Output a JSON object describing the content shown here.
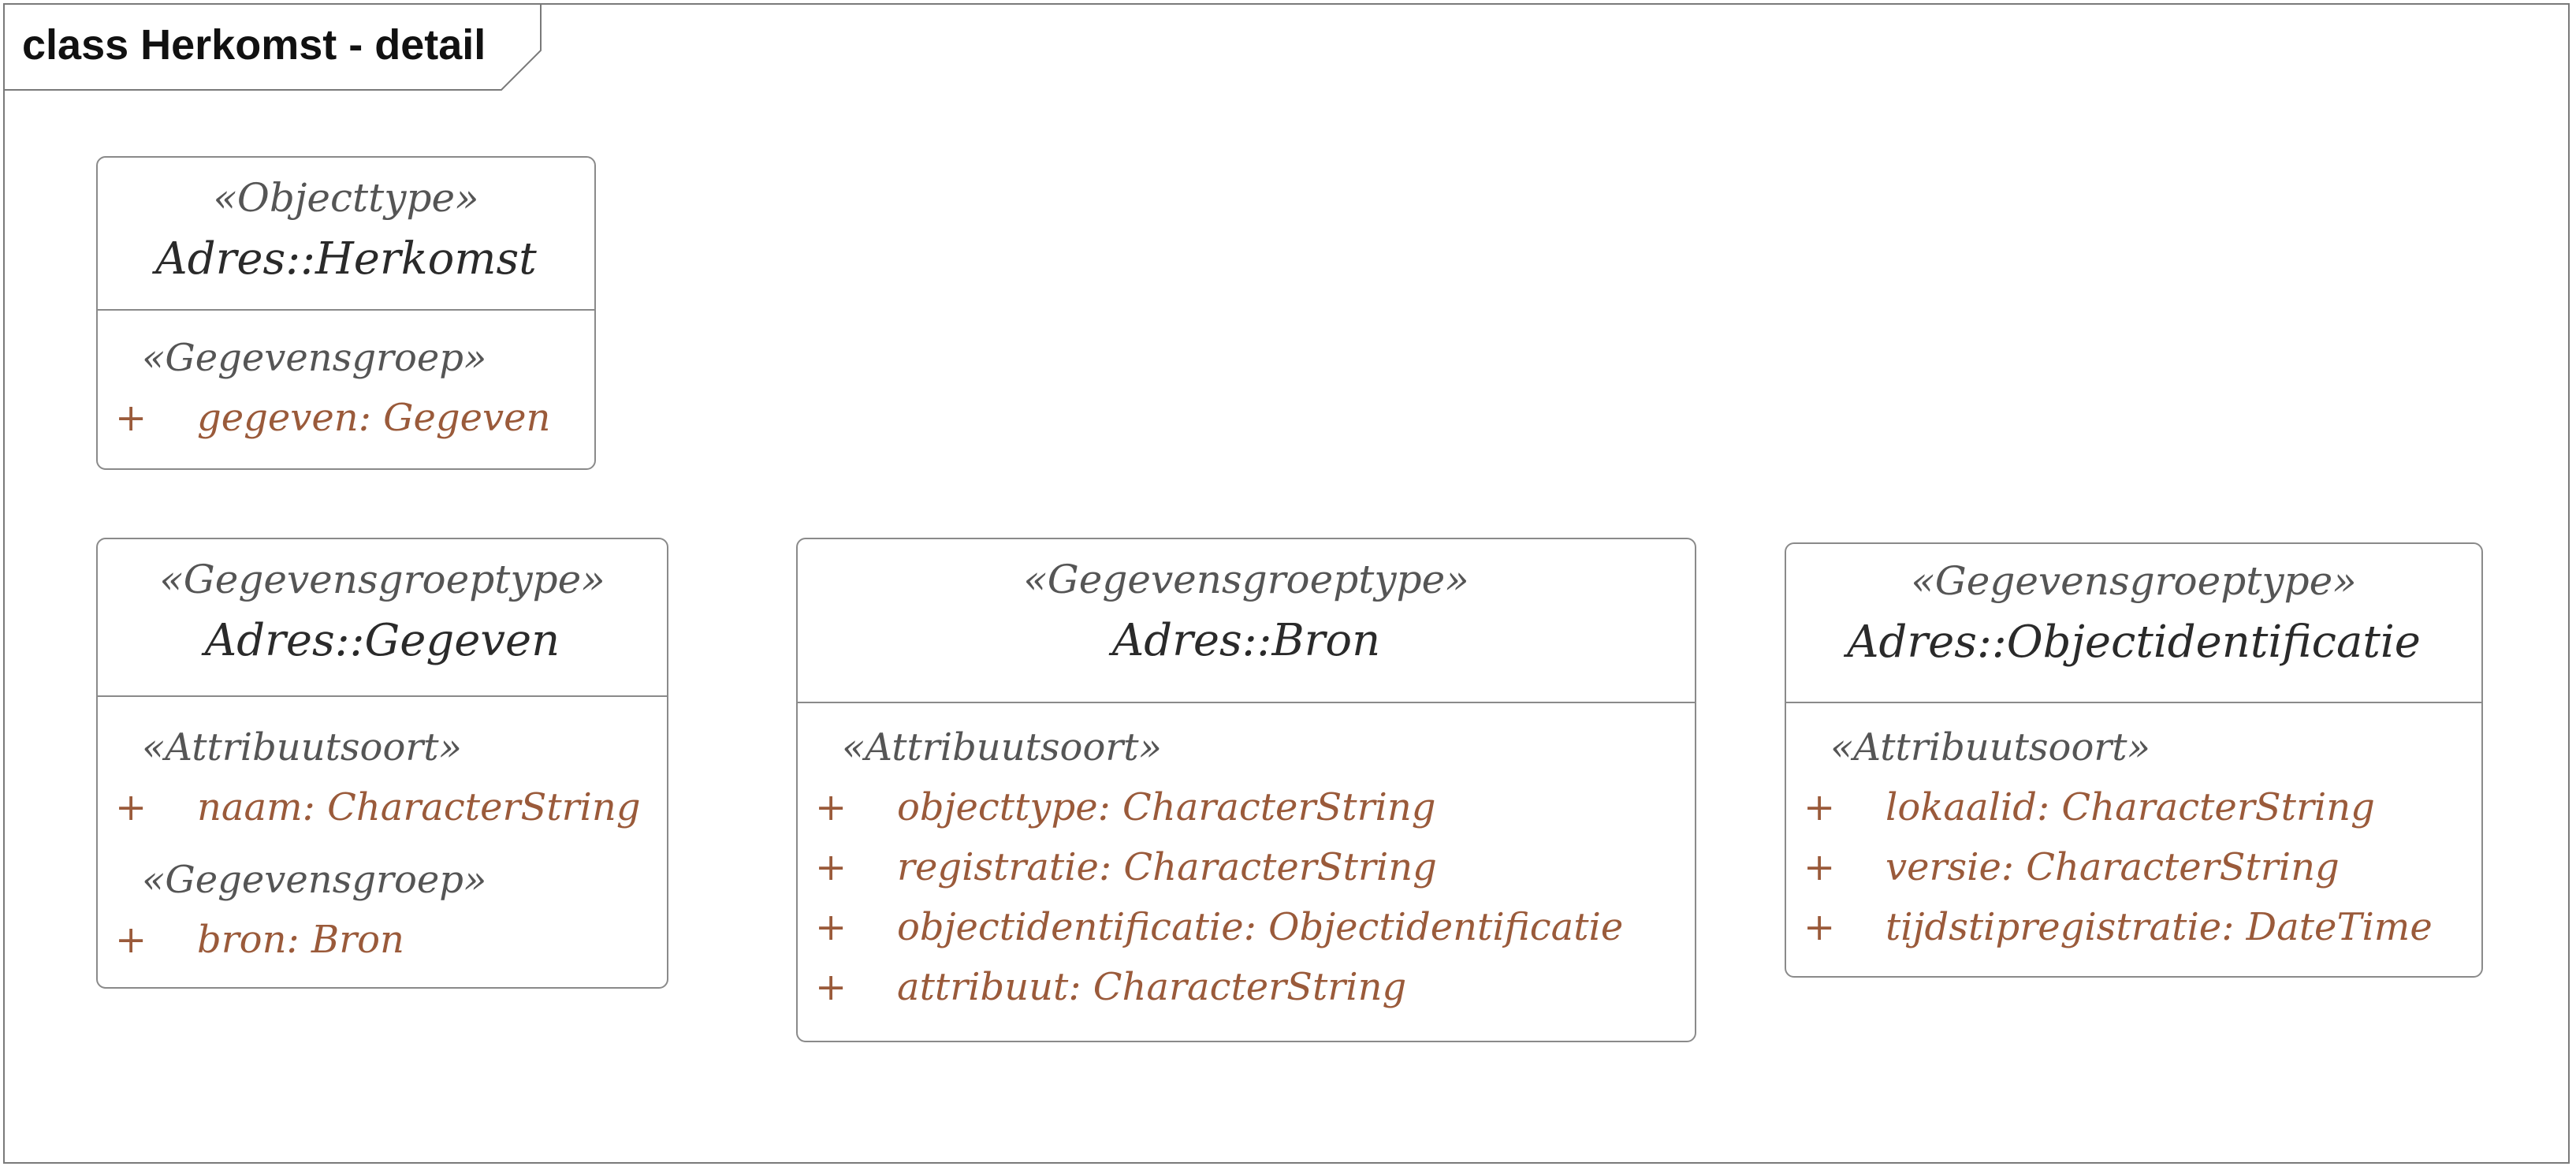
{
  "frame": {
    "title": "class Herkomst - detail"
  },
  "classes": {
    "herkomst": {
      "stereotype": "«Objecttype»",
      "name": "Adres::Herkomst",
      "sections": [
        {
          "stereotype": "«Gegevensgroep»",
          "attributes": [
            {
              "visibility": "+",
              "text": "gegeven: Gegeven"
            }
          ]
        }
      ]
    },
    "gegeven": {
      "stereotype": "«Gegevensgroeptype»",
      "name": "Adres::Gegeven",
      "sections": [
        {
          "stereotype": "«Attribuutsoort»",
          "attributes": [
            {
              "visibility": "+",
              "text": "naam: CharacterString"
            }
          ]
        },
        {
          "stereotype": "«Gegevensgroep»",
          "attributes": [
            {
              "visibility": "+",
              "text": "bron: Bron"
            }
          ]
        }
      ]
    },
    "bron": {
      "stereotype": "«Gegevensgroeptype»",
      "name": "Adres::Bron",
      "sections": [
        {
          "stereotype": "«Attribuutsoort»",
          "attributes": [
            {
              "visibility": "+",
              "text": "objecttype: CharacterString"
            },
            {
              "visibility": "+",
              "text": "registratie: CharacterString"
            },
            {
              "visibility": "+",
              "text": "objectidentificatie: Objectidentificatie"
            },
            {
              "visibility": "+",
              "text": "attribuut: CharacterString"
            }
          ]
        }
      ]
    },
    "objectidentificatie": {
      "stereotype": "«Gegevensgroeptype»",
      "name": "Adres::Objectidentificatie",
      "sections": [
        {
          "stereotype": "«Attribuutsoort»",
          "attributes": [
            {
              "visibility": "+",
              "text": "lokaalid: CharacterString"
            },
            {
              "visibility": "+",
              "text": "versie: CharacterString"
            },
            {
              "visibility": "+",
              "text": "tijdstipregistratie: DateTime"
            }
          ]
        }
      ]
    }
  },
  "colors": {
    "border": "#8a8a8a",
    "attribute": "#9a5a3a",
    "stereotype": "#555555",
    "name": "#2a2a2a"
  }
}
